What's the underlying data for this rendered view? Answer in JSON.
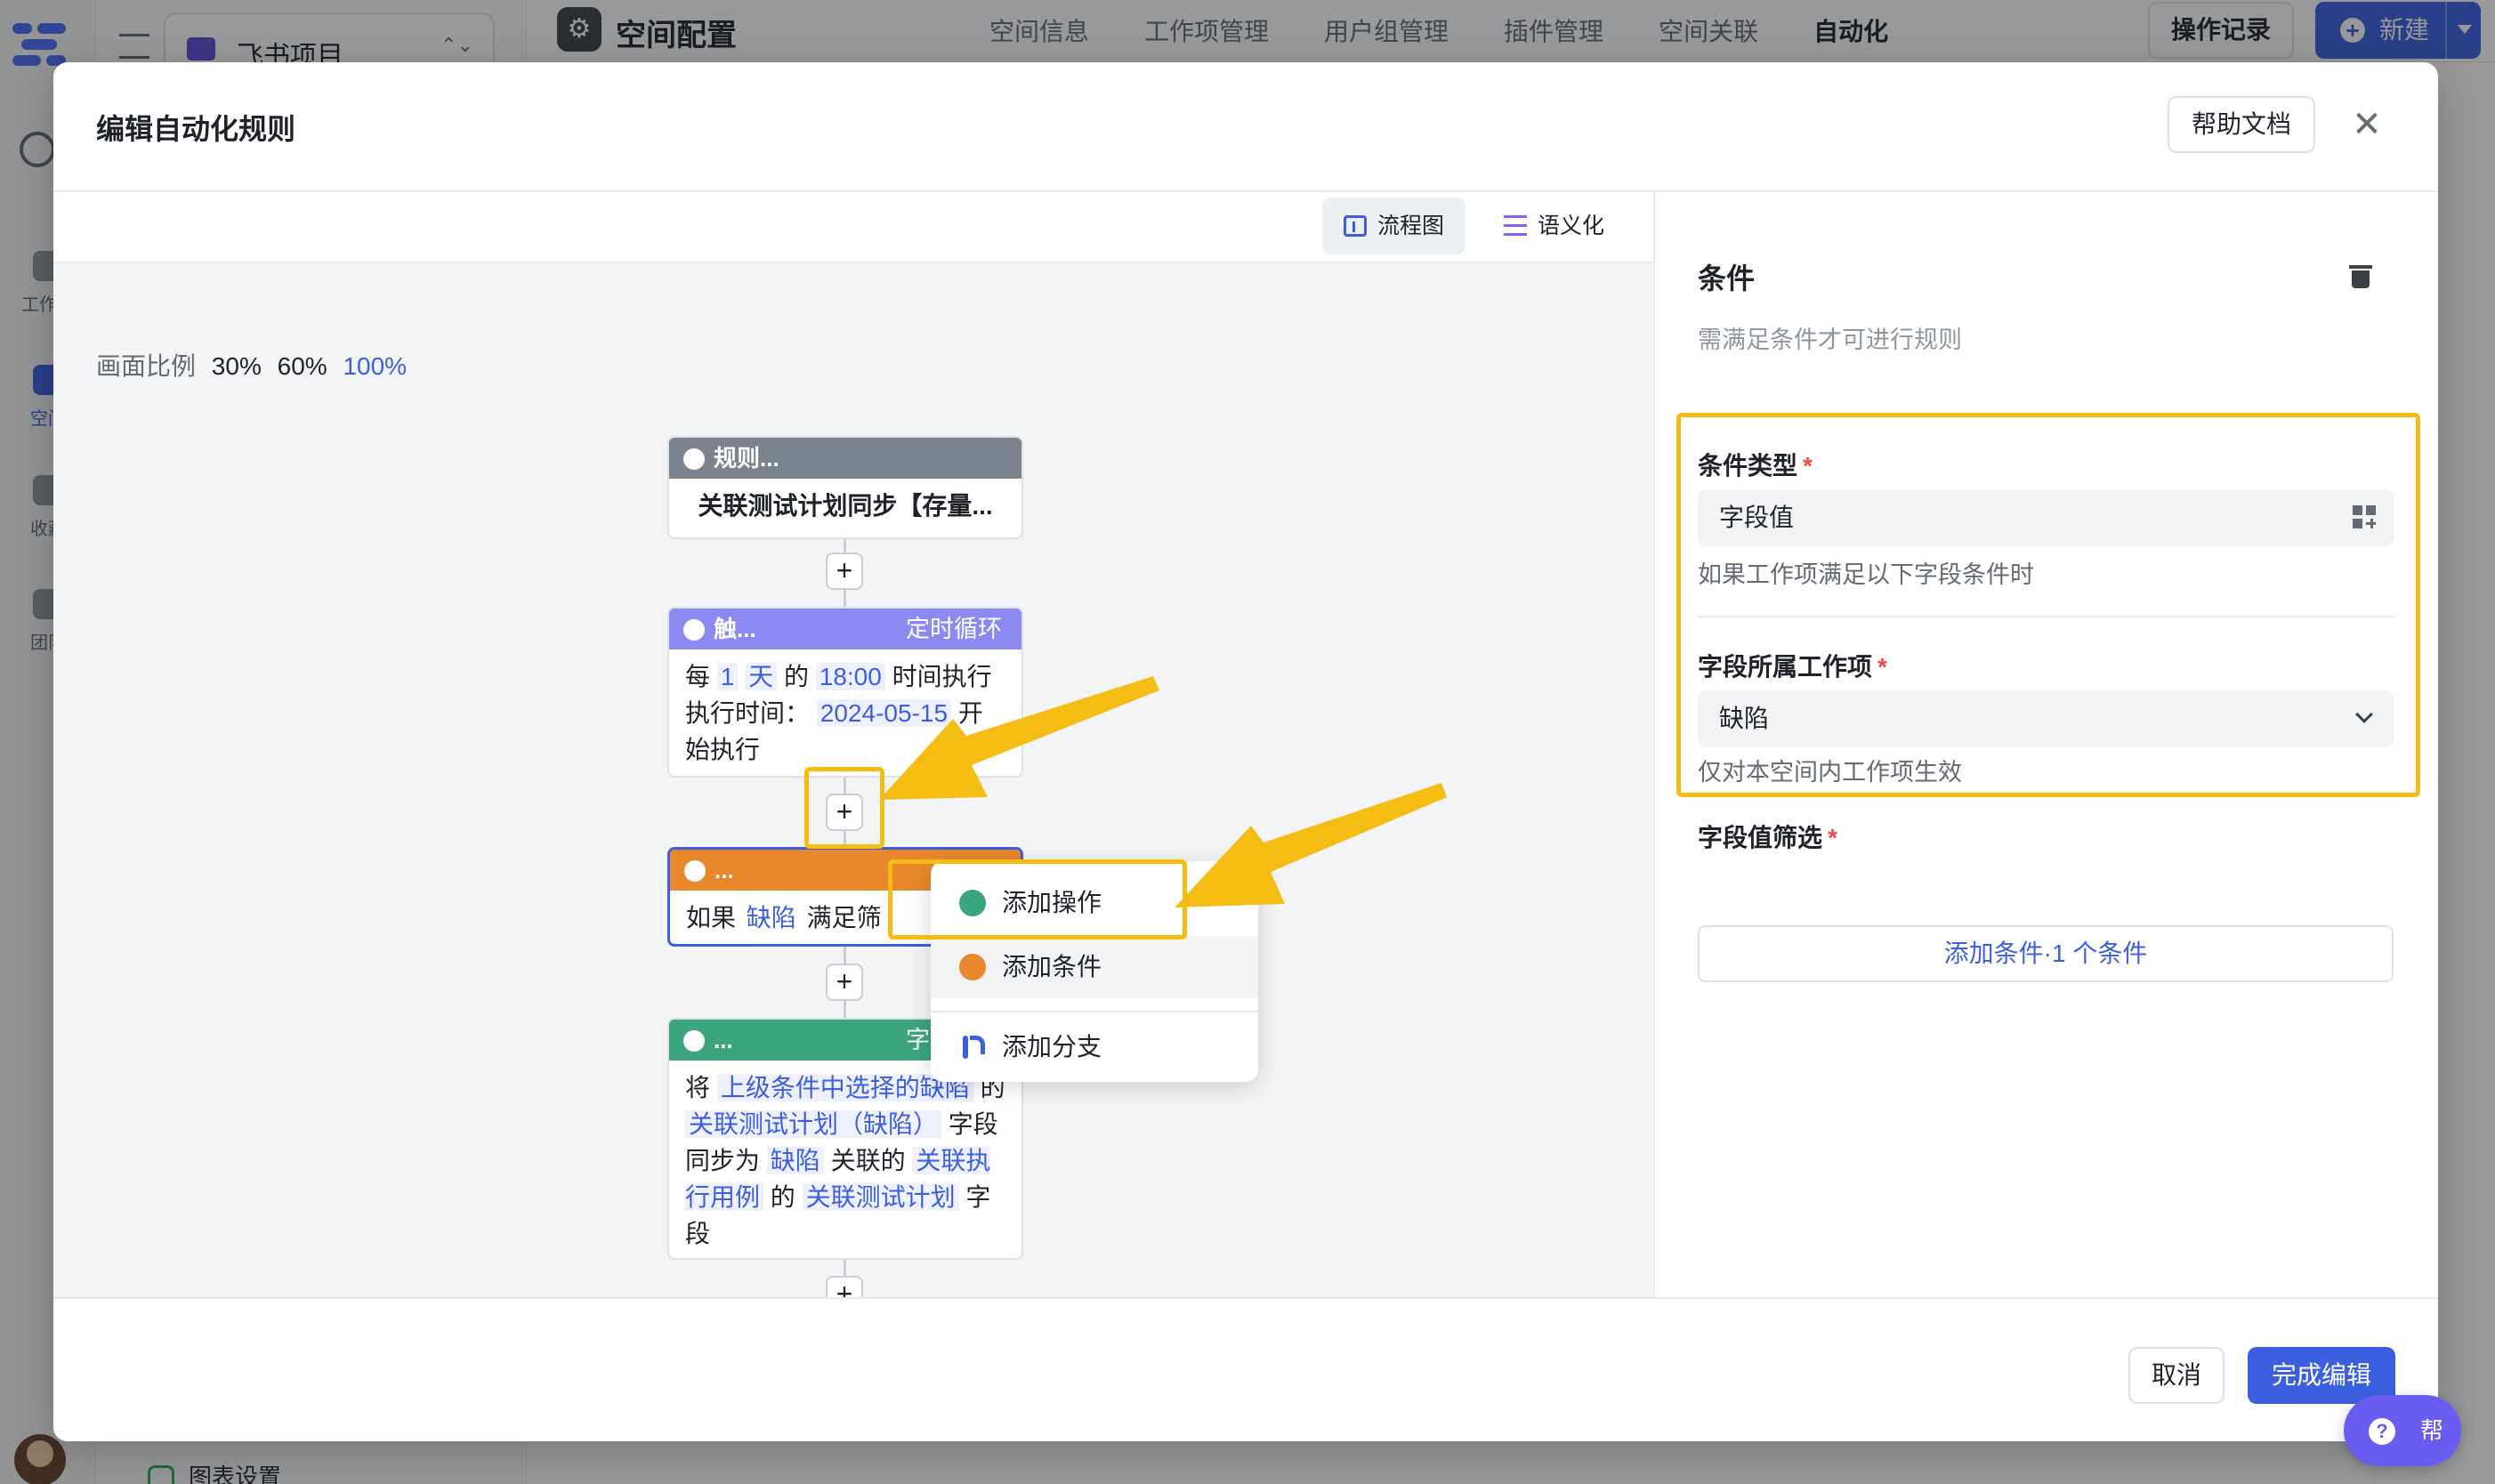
{
  "background": {
    "project_name": "飞书项目",
    "page_title": "空间配置",
    "tabs": [
      "空间信息",
      "工作项管理",
      "用户组管理",
      "插件管理",
      "空间关联",
      "自动化"
    ],
    "active_tab": "自动化",
    "operation_log": "操作记录",
    "new_button": "新建",
    "rail": [
      "工作台",
      "空间",
      "收藏",
      "团队"
    ],
    "chart_setting": "图表设置"
  },
  "modal": {
    "title": "编辑自动化规则",
    "help_doc": "帮助文档",
    "close": "✕"
  },
  "canvas": {
    "view_tabs": [
      "流程图",
      "语义化"
    ],
    "scale_label": "画面比例",
    "scales": [
      "30%",
      "60%",
      "100%"
    ],
    "active_scale": "100%",
    "plus": "+",
    "nodes": {
      "rule": {
        "title": "规则...",
        "body": "关联测试计划同步【存量..."
      },
      "trigger": {
        "title": "触...",
        "tag": "定时循环",
        "t1": "每",
        "v1": "1",
        "v2": "天",
        "t2": "的",
        "v3": "18:00",
        "t3": "时间执行",
        "t4": "执行时间：",
        "v4": "2024-05-15",
        "t5": "开始执行"
      },
      "condition": {
        "title": "...",
        "t1": "如果",
        "v1": "缺陷",
        "t2": "满足筛"
      },
      "action": {
        "title": "...",
        "tag": "字段操作",
        "t1": "将",
        "v1": "上级条件中选择的缺陷",
        "t2": "的",
        "v2": "关联测试计划（缺陷）",
        "t3": "字段",
        "t4": "同步为",
        "v3": "缺陷",
        "t5": "关联的",
        "v4": "关联执行用例",
        "t6": "的",
        "v5": "关联测试计划",
        "t7": "字段"
      },
      "more": {
        "title": "..."
      }
    },
    "menu": [
      "添加操作",
      "添加条件",
      "添加分支"
    ]
  },
  "panel": {
    "title": "条件",
    "desc": "需满足条件才可进行规则",
    "condition_type_label": "条件类型",
    "condition_type_value": "字段值",
    "condition_type_hint": "如果工作项满足以下字段条件时",
    "work_item_label": "字段所属工作项",
    "work_item_value": "缺陷",
    "work_item_hint": "仅对本空间内工作项生效",
    "filter_label": "字段值筛选",
    "filter_button": "添加条件·1 个条件",
    "required_mark": "*"
  },
  "footer": {
    "cancel": "取消",
    "done": "完成编辑"
  },
  "help_fab": {
    "label": "帮助",
    "icon": "?"
  },
  "colors": {
    "accent": "#3c5fe0",
    "highlight": "#f5bd14",
    "trigger": "#8c8af0",
    "condition": "#e8872c",
    "action": "#3ca57e"
  }
}
